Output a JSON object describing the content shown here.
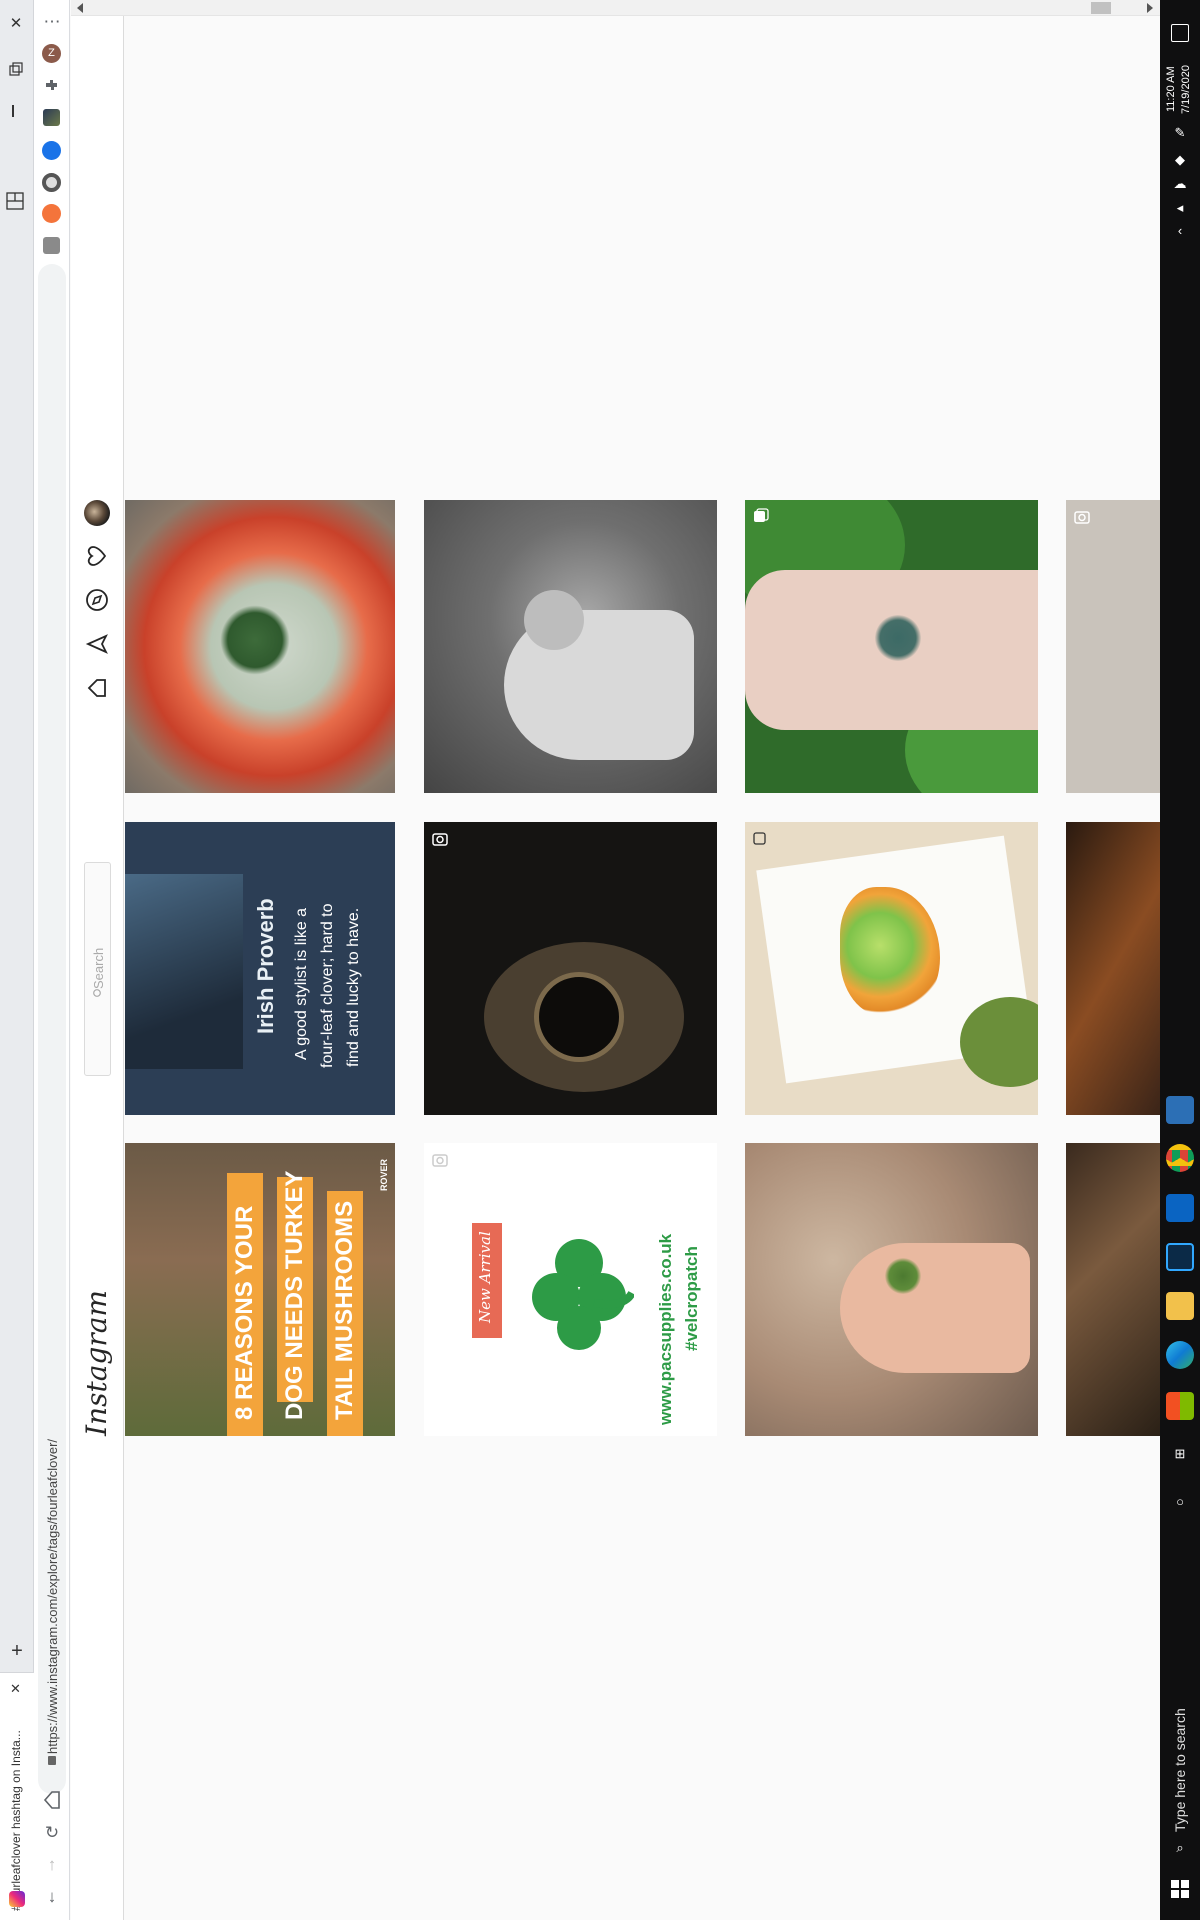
{
  "browser": {
    "tab_title": "#fourleafclover hashtag on Insta...",
    "url": "https://www.instagram.com/explore/tags/fourleafclover/",
    "new_tab_glyph": "+",
    "close_glyph": "✕",
    "ext_letter": "Z"
  },
  "instagram": {
    "logo": "Instagram",
    "search_placeholder": "Search",
    "grid": [
      {
        "name": "resin-clover-bowl",
        "badge": "none"
      },
      {
        "name": "bw-hand-clover",
        "badge": "none"
      },
      {
        "name": "clover-tattoo",
        "badge": "carousel"
      },
      {
        "name": "necklace-partial",
        "badge": "camera"
      },
      {
        "name": "irish-proverb-post",
        "badge": "none",
        "title": "Irish Proverb",
        "line1": "A good stylist is like a",
        "line2": "four-leaf clover; hard to",
        "line3": "find and lucky to have."
      },
      {
        "name": "guitar-dark",
        "badge": "camera"
      },
      {
        "name": "leprechaun-drawing",
        "badge": "carousel"
      },
      {
        "name": "violin-partial",
        "badge": "none"
      },
      {
        "name": "turkey-tail-mushrooms",
        "badge": "none",
        "line1": "8 REASONS YOUR",
        "line2": "DOG NEEDS TURKEY",
        "line3": "TAIL MUSHROOMS",
        "brand": "ROVER"
      },
      {
        "name": "shamrock-patch",
        "badge": "camera",
        "ribbon": "New Arrival",
        "url": "www.pacsupplies.co.uk",
        "tag": "#velcropatch"
      },
      {
        "name": "fingertip-clover",
        "badge": "none"
      },
      {
        "name": "mulch-partial",
        "badge": "none"
      }
    ]
  },
  "taskbar": {
    "search_text": "Type here to search",
    "time": "11:20 AM",
    "date": "7/19/2020"
  },
  "colors": {
    "taskbar_bg": "#0f0f10",
    "ig_border": "#dbdbdb",
    "clover_green": "#2d9b46",
    "banner_orange": "#f3a43b",
    "proverb_bg": "#2c3e55"
  }
}
